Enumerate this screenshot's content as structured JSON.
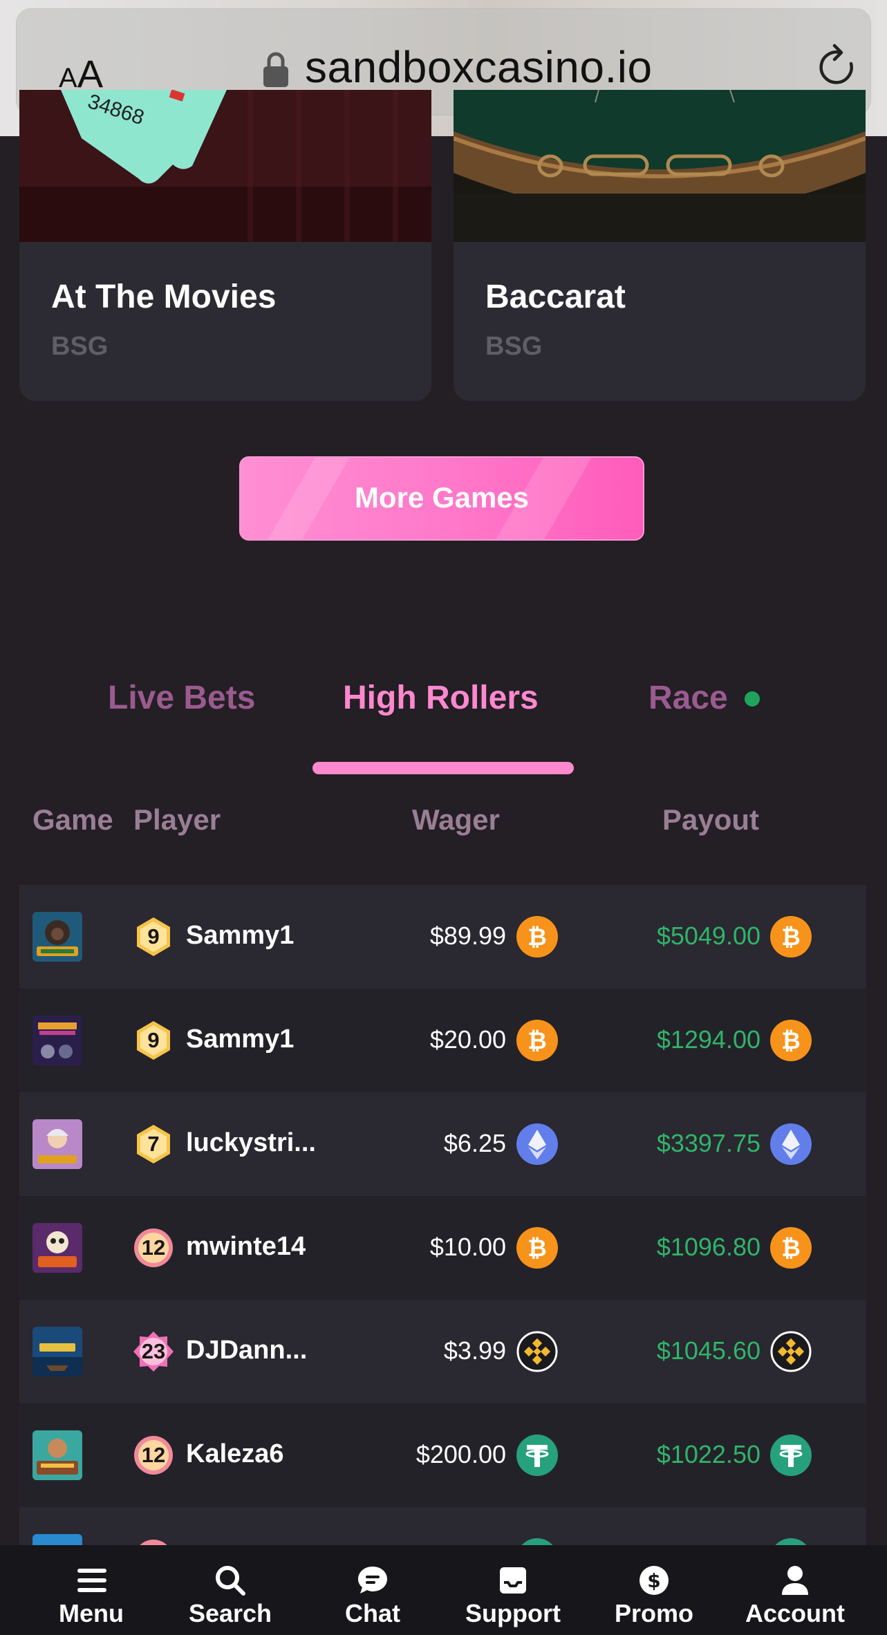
{
  "browser": {
    "text_size_small": "A",
    "text_size_big": "A",
    "url": "sandboxcasino.io"
  },
  "game_cards": [
    {
      "title": "At The Movies",
      "provider": "BSG"
    },
    {
      "title": "Baccarat",
      "provider": "BSG"
    }
  ],
  "more_games_label": "More Games",
  "tabs": [
    {
      "label": "Live Bets",
      "active": false
    },
    {
      "label": "High Rollers",
      "active": true
    },
    {
      "label": "Race",
      "active": false,
      "live_indicator": true
    }
  ],
  "columns": {
    "game": "Game",
    "player": "Player",
    "wager": "Wager",
    "payout": "Payout"
  },
  "rows": [
    {
      "game_icon": "gorilla-slot-icon",
      "level": "9",
      "level_style": "gold",
      "player": "Sammy1",
      "wager": "$89.99",
      "wager_coin": "bitcoin-icon",
      "payout": "$5049.00",
      "payout_coin": "bitcoin-icon"
    },
    {
      "game_icon": "howling-wolves-slot-icon",
      "level": "9",
      "level_style": "gold",
      "player": "Sammy1",
      "wager": "$20.00",
      "wager_coin": "bitcoin-icon",
      "payout": "$1294.00",
      "payout_coin": "bitcoin-icon"
    },
    {
      "game_icon": "olympus-slot-icon",
      "level": "7",
      "level_style": "gold",
      "player": "luckystri...",
      "wager": "$6.25",
      "wager_coin": "ethereum-icon",
      "payout": "$3397.75",
      "payout_coin": "ethereum-icon"
    },
    {
      "game_icon": "dia-de-muertos-slot-icon",
      "level": "12",
      "level_style": "rose",
      "player": "mwinte14",
      "wager": "$10.00",
      "wager_coin": "bitcoin-icon",
      "payout": "$1096.80",
      "payout_coin": "bitcoin-icon"
    },
    {
      "game_icon": "mystic-wreck-slot-icon",
      "level": "23",
      "level_style": "pink",
      "player": "DJDann...",
      "wager": "$3.99",
      "wager_coin": "binance-icon",
      "payout": "$1045.60",
      "payout_coin": "binance-icon"
    },
    {
      "game_icon": "bermuda-riches-slot-icon",
      "level": "12",
      "level_style": "rose",
      "player": "Kaleza6",
      "wager": "$200.00",
      "wager_coin": "tether-icon",
      "payout": "$1022.50",
      "payout_coin": "tether-icon"
    }
  ],
  "bottom_nav": [
    {
      "label": "Menu",
      "icon": "hamburger-menu-icon"
    },
    {
      "label": "Search",
      "icon": "search-icon"
    },
    {
      "label": "Chat",
      "icon": "chat-bubble-icon"
    },
    {
      "label": "Support",
      "icon": "inbox-icon"
    },
    {
      "label": "Promo",
      "icon": "dollar-circle-icon"
    },
    {
      "label": "Account",
      "icon": "user-icon"
    }
  ],
  "colors": {
    "background": "#231f25",
    "accent_pink": "#ff88cf",
    "payout_green": "#2fb56a",
    "muted_tab": "#9b5b8f",
    "bitcoin": "#f7931a",
    "ethereum": "#627eea",
    "tether": "#26a17b",
    "binance": "#f3ba2f"
  }
}
